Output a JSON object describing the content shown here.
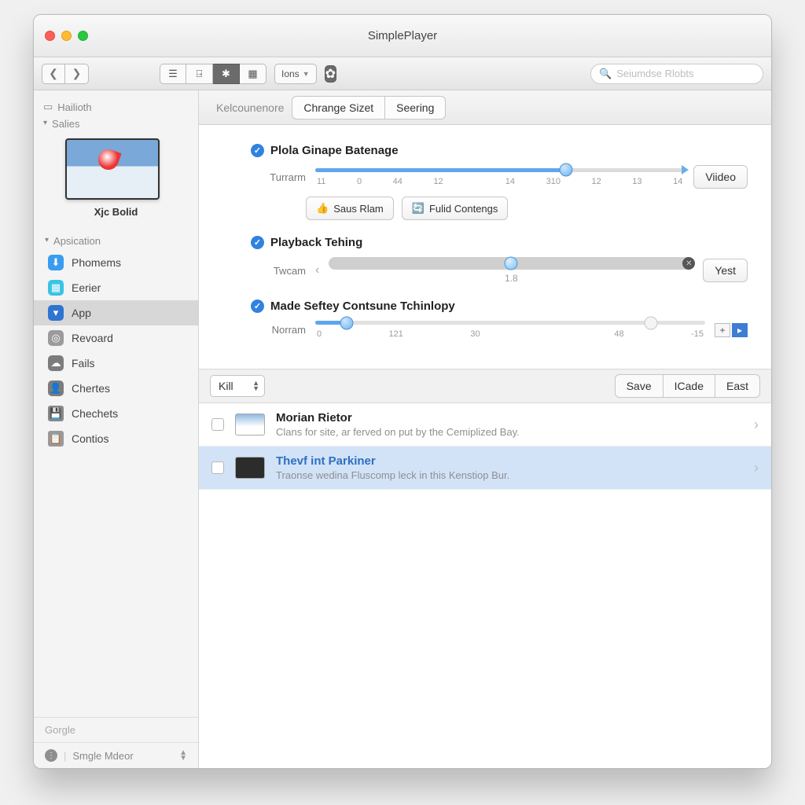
{
  "window": {
    "title": "SimplePlayer"
  },
  "toolbar": {
    "viewmode_label": "Ions",
    "search_placeholder": "Seiumdse Rlobts"
  },
  "sidebar": {
    "top_label": "Hailioth",
    "group1_label": "Salies",
    "thumb_caption": "Xjc Bolid",
    "group2_label": "Apsication",
    "items": [
      {
        "label": "Phomems",
        "icon": "download-icon",
        "color": "blue"
      },
      {
        "label": "Eerier",
        "icon": "grid-icon",
        "color": "teal"
      },
      {
        "label": "App",
        "icon": "play-icon",
        "color": "dblue",
        "selected": true
      },
      {
        "label": "Revoard",
        "icon": "disc-icon",
        "color": "gray"
      },
      {
        "label": "Fails",
        "icon": "cloud-icon",
        "color": "dk"
      },
      {
        "label": "Chertes",
        "icon": "person-icon",
        "color": "dk"
      },
      {
        "label": "Chechets",
        "icon": "save-icon",
        "color": "ol"
      },
      {
        "label": "Contios",
        "icon": "clipboard-icon",
        "color": "ol2"
      }
    ],
    "footer1": "Gorgle",
    "footer2": "Smgle Mdeor"
  },
  "tabs": {
    "crumb": "Kelcounenore",
    "items": [
      "Chrange Sizet",
      "Seering"
    ]
  },
  "section1": {
    "title": "Plola Ginape Batenage",
    "slider_label": "Turrarm",
    "ticks": [
      "11",
      "0",
      "44",
      "12",
      "",
      "14",
      "310",
      "12",
      "13",
      "14"
    ],
    "knob_percent": 68,
    "end_label": "Viideo",
    "btn1": "Saus Rlam",
    "btn2": "Fulid Contengs"
  },
  "section2": {
    "title": "Playback Tehing",
    "slider_label": "Twcam",
    "value_label": "1.8",
    "knob_percent": 50,
    "end_btn": "Yest"
  },
  "section3": {
    "title": "Made Seftey Contsune Tchinlopy",
    "slider_label": "Norram",
    "ticks": [
      "0",
      "121",
      "30",
      "",
      "48",
      "-15"
    ],
    "knob_percent": 8,
    "stepper_plus": "+"
  },
  "listbar": {
    "select": "Kill",
    "buttons": [
      "Save",
      "ICade",
      "East"
    ]
  },
  "rows": [
    {
      "title": "Morian Rietor",
      "sub": "Clans for site, ar ferved on put by the Cemiplized Bay.",
      "selected": false,
      "link": false
    },
    {
      "title": "Thevf int Parkiner",
      "sub": "Traonse wedina Fluscomp leck in this Kenstiop Bur.",
      "selected": true,
      "link": true
    }
  ]
}
